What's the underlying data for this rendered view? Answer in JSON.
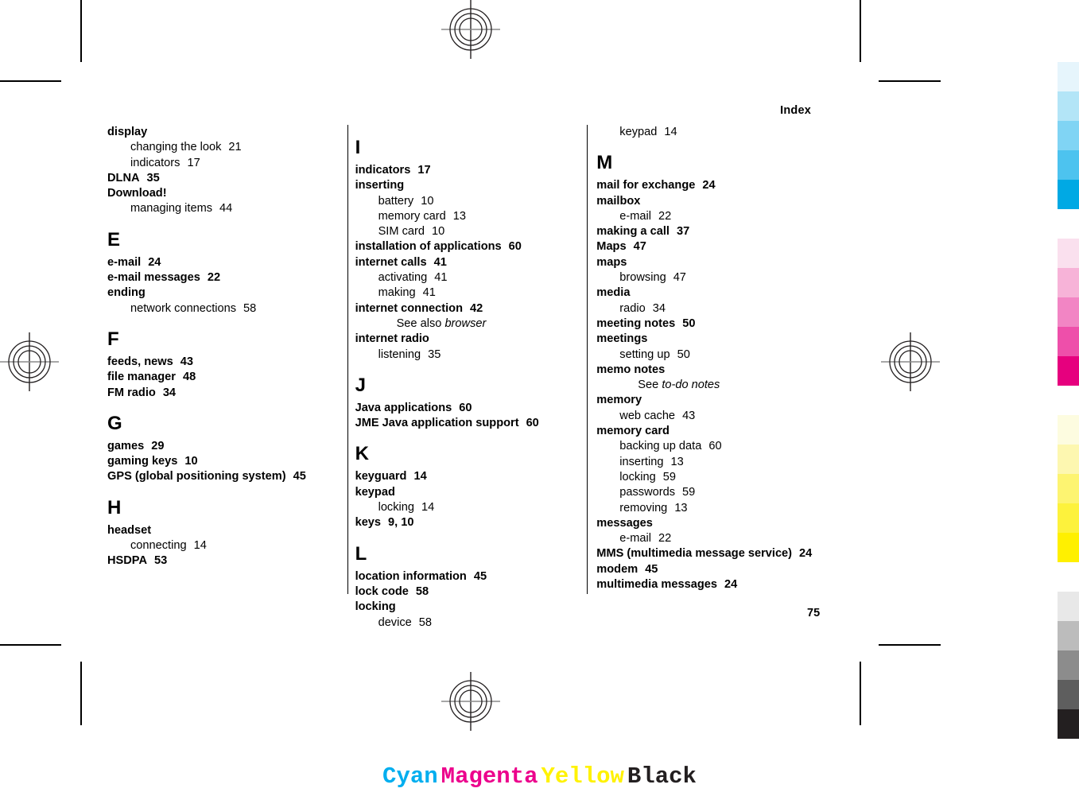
{
  "document": {
    "running_head": "Index",
    "folio": "75"
  },
  "columns": [
    {
      "id": "column-1",
      "blocks": [
        {
          "type": "entry",
          "text": "display"
        },
        {
          "type": "sub",
          "text": "changing the look",
          "page": "21"
        },
        {
          "type": "sub",
          "text": "indicators",
          "page": "17"
        },
        {
          "type": "entry",
          "text": "DLNA",
          "page": "35"
        },
        {
          "type": "entry",
          "text": "Download!"
        },
        {
          "type": "sub",
          "text": "managing items",
          "page": "44"
        },
        {
          "type": "letter",
          "text": "E"
        },
        {
          "type": "entry",
          "text": "e-mail",
          "page": "24"
        },
        {
          "type": "entry",
          "text": "e-mail messages",
          "page": "22"
        },
        {
          "type": "entry",
          "text": "ending"
        },
        {
          "type": "sub",
          "text": "network connections",
          "page": "58"
        },
        {
          "type": "letter",
          "text": "F"
        },
        {
          "type": "entry",
          "text": "feeds, news",
          "page": "43"
        },
        {
          "type": "entry",
          "text": "file manager",
          "page": "48"
        },
        {
          "type": "entry",
          "text": "FM radio",
          "page": "34"
        },
        {
          "type": "letter",
          "text": "G"
        },
        {
          "type": "entry",
          "text": "games",
          "page": "29"
        },
        {
          "type": "entry",
          "text": "gaming keys",
          "page": "10"
        },
        {
          "type": "entry",
          "text": "GPS (global positioning system)",
          "page": "45"
        },
        {
          "type": "letter",
          "text": "H"
        },
        {
          "type": "entry",
          "text": "headset"
        },
        {
          "type": "sub",
          "text": "connecting",
          "page": "14"
        },
        {
          "type": "entry",
          "text": "HSDPA",
          "page": "53"
        }
      ]
    },
    {
      "id": "column-2",
      "blocks": [
        {
          "type": "letter",
          "text": "I"
        },
        {
          "type": "entry",
          "text": "indicators",
          "page": "17"
        },
        {
          "type": "entry",
          "text": "inserting"
        },
        {
          "type": "sub",
          "text": "battery",
          "page": "10"
        },
        {
          "type": "sub",
          "text": "memory card",
          "page": "13"
        },
        {
          "type": "sub",
          "text": "SIM card",
          "page": "10"
        },
        {
          "type": "entry",
          "text": "installation of applications",
          "page": "60"
        },
        {
          "type": "entry",
          "text": "internet calls",
          "page": "41"
        },
        {
          "type": "sub",
          "text": "activating",
          "page": "41"
        },
        {
          "type": "sub",
          "text": "making",
          "page": "41"
        },
        {
          "type": "entry",
          "text": "internet connection",
          "page": "42"
        },
        {
          "type": "xref",
          "text": "See also",
          "target": "browser"
        },
        {
          "type": "entry",
          "text": "internet radio"
        },
        {
          "type": "sub",
          "text": "listening",
          "page": "35"
        },
        {
          "type": "letter",
          "text": "J"
        },
        {
          "type": "entry",
          "text": "Java applications",
          "page": "60"
        },
        {
          "type": "entry",
          "text": "JME Java application support",
          "page": "60"
        },
        {
          "type": "letter",
          "text": "K"
        },
        {
          "type": "entry",
          "text": "keyguard",
          "page": "14"
        },
        {
          "type": "entry",
          "text": "keypad"
        },
        {
          "type": "sub",
          "text": "locking",
          "page": "14"
        },
        {
          "type": "entry",
          "text": "keys",
          "page": "9, 10"
        },
        {
          "type": "letter",
          "text": "L"
        },
        {
          "type": "entry",
          "text": "location information",
          "page": "45"
        },
        {
          "type": "entry",
          "text": "lock code",
          "page": "58"
        },
        {
          "type": "entry",
          "text": "locking"
        },
        {
          "type": "sub",
          "text": "device",
          "page": "58"
        }
      ]
    },
    {
      "id": "column-3",
      "blocks": [
        {
          "type": "sub",
          "text": "keypad",
          "page": "14"
        },
        {
          "type": "letter",
          "text": "M"
        },
        {
          "type": "entry",
          "text": "mail for exchange",
          "page": "24"
        },
        {
          "type": "entry",
          "text": "mailbox"
        },
        {
          "type": "sub",
          "text": "e-mail",
          "page": "22"
        },
        {
          "type": "entry",
          "text": "making a call",
          "page": "37"
        },
        {
          "type": "entry",
          "text": "Maps",
          "page": "47"
        },
        {
          "type": "entry",
          "text": "maps"
        },
        {
          "type": "sub",
          "text": "browsing",
          "page": "47"
        },
        {
          "type": "entry",
          "text": "media"
        },
        {
          "type": "sub",
          "text": "radio",
          "page": "34"
        },
        {
          "type": "entry",
          "text": "meeting notes",
          "page": "50"
        },
        {
          "type": "entry",
          "text": "meetings"
        },
        {
          "type": "sub",
          "text": "setting up",
          "page": "50"
        },
        {
          "type": "entry",
          "text": "memo notes"
        },
        {
          "type": "xref",
          "text": "See",
          "target": "to-do notes"
        },
        {
          "type": "entry",
          "text": "memory"
        },
        {
          "type": "sub",
          "text": "web cache",
          "page": "43"
        },
        {
          "type": "entry",
          "text": "memory card"
        },
        {
          "type": "sub",
          "text": "backing up data",
          "page": "60"
        },
        {
          "type": "sub",
          "text": "inserting",
          "page": "13"
        },
        {
          "type": "sub",
          "text": "locking",
          "page": "59"
        },
        {
          "type": "sub",
          "text": "passwords",
          "page": "59"
        },
        {
          "type": "sub",
          "text": "removing",
          "page": "13"
        },
        {
          "type": "entry",
          "text": "messages"
        },
        {
          "type": "sub",
          "text": "e-mail",
          "page": "22"
        },
        {
          "type": "entry",
          "text": "MMS (multimedia message service)",
          "page": "24"
        },
        {
          "type": "entry",
          "text": "modem",
          "page": "45"
        },
        {
          "type": "entry",
          "text": "multimedia messages",
          "page": "24"
        }
      ]
    }
  ],
  "calibration_bar": {
    "swatches": [
      "#e6f5fc",
      "#b3e5f7",
      "#80d4f4",
      "#4dc3ef",
      "#00a9e4",
      "#ffffff",
      "#fae0ee",
      "#f7b3d8",
      "#f285c4",
      "#ee4faa",
      "#e6007e",
      "#ffffff",
      "#fdfce0",
      "#fdf7b0",
      "#fdf471",
      "#fdf23c",
      "#fff000",
      "#ffffff",
      "#e8e8e8",
      "#bcbcbc",
      "#8c8c8c",
      "#5e5e5e",
      "#231f20"
    ]
  },
  "cmyk_legend": {
    "items": [
      {
        "label": "Cyan",
        "color": "#00aeef"
      },
      {
        "label": "Magenta",
        "color": "#ec008c"
      },
      {
        "label": "Yellow",
        "color": "#fff200"
      },
      {
        "label": "Black",
        "color": "#231f20"
      }
    ]
  }
}
